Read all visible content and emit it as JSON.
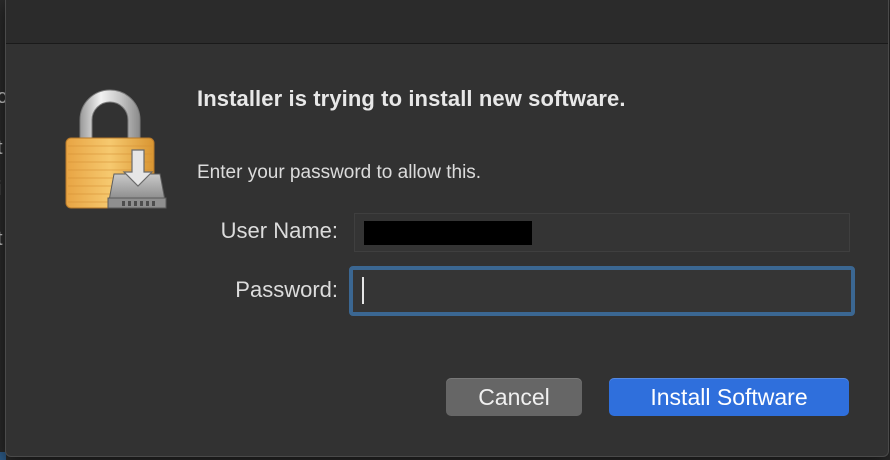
{
  "background": {
    "edge_chars": [
      "c",
      "t",
      "i",
      "t"
    ]
  },
  "dialog": {
    "title": "Installer is trying to install new software.",
    "message": "Enter your password to allow this.",
    "icon": "lock-with-installer-disk-icon",
    "username_label": "User Name:",
    "username_value": "",
    "username_redacted": true,
    "password_label": "Password:",
    "password_value": "",
    "password_focused": true,
    "cancel_label": "Cancel",
    "install_label": "Install Software"
  },
  "colors": {
    "dialog_bg": "#323232",
    "primary_button": "#2f6fdc",
    "secondary_button": "#666666",
    "focus_ring": "#3b6792"
  }
}
